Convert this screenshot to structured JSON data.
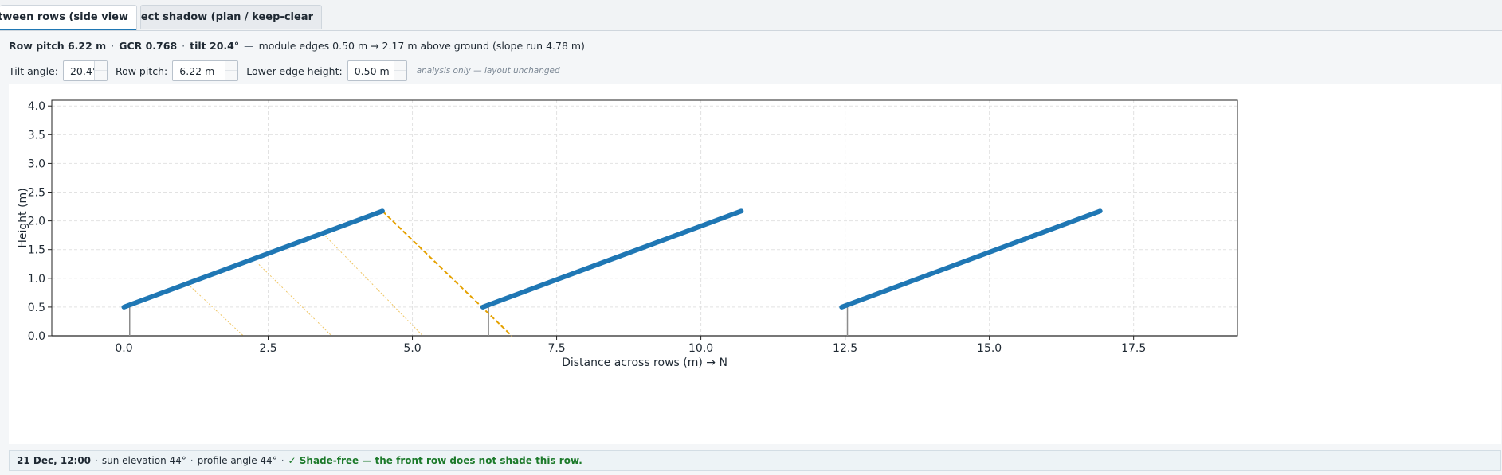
{
  "tabs": [
    {
      "label": "Shading between rows (side view",
      "active": true
    },
    {
      "label": "Object shadow (plan / keep-clear",
      "active": false
    }
  ],
  "summary": {
    "pitch": "Row pitch 6.22 m",
    "gcr": "GCR 0.768",
    "tilt": "tilt 20.4°",
    "dash": "—",
    "dot": "·",
    "details": "module edges 0.50 m → 2.17 m above ground (slope run 4.78 m)"
  },
  "controls": {
    "tilt_label": "Tilt angle:",
    "tilt_value": "20.4°",
    "pitch_label": "Row pitch:",
    "pitch_value": "6.22 m",
    "edge_label": "Lower-edge height:",
    "edge_value": "0.50 m",
    "note": "analysis only — layout unchanged"
  },
  "colors": {
    "module": "#1f77b4",
    "shade_ray": "#e5a100",
    "post": "#8c8c8c",
    "ground": "#999999",
    "ok_text": "#1c7a2a"
  },
  "chart_data": {
    "type": "line",
    "xlabel": "Distance across rows (m)  →  N",
    "ylabel": "Height (m)",
    "xlim": [
      -1.25,
      19.3
    ],
    "ylim": [
      0,
      4.1
    ],
    "xticks": [
      0,
      2.5,
      5,
      7.5,
      10,
      12.5,
      15,
      17.5
    ],
    "xtick_labels": [
      "0.0",
      "2.5",
      "5.0",
      "7.5",
      "10.0",
      "12.5",
      "15.0",
      "17.5"
    ],
    "yticks": [
      0,
      0.5,
      1,
      1.5,
      2,
      2.5,
      3,
      3.5,
      4
    ],
    "ytick_labels": [
      "0.0",
      "0.5",
      "1.0",
      "1.5",
      "2.0",
      "2.5",
      "3.0",
      "3.5",
      "4.0"
    ],
    "grid": true,
    "modules": [
      {
        "x": [
          0,
          4.48
        ],
        "y": [
          0.5,
          2.17
        ]
      },
      {
        "x": [
          6.22,
          10.7
        ],
        "y": [
          0.5,
          2.17
        ]
      },
      {
        "x": [
          12.44,
          16.92
        ],
        "y": [
          0.5,
          2.17
        ]
      }
    ],
    "posts": [
      {
        "x": 0.1,
        "y": [
          0,
          0.5
        ]
      },
      {
        "x": 6.32,
        "y": [
          0,
          0.5
        ]
      },
      {
        "x": 12.54,
        "y": [
          0,
          0.5
        ]
      }
    ],
    "shadow_rays": [
      {
        "x": [
          4.48,
          6.72
        ],
        "y": [
          2.17,
          0
        ],
        "style": "dashed"
      },
      {
        "x": [
          1.15,
          2.07
        ],
        "y": [
          0.86,
          0
        ],
        "style": "dotted"
      },
      {
        "x": [
          2.3,
          3.6
        ],
        "y": [
          1.28,
          0
        ],
        "style": "dotted"
      },
      {
        "x": [
          3.45,
          5.18
        ],
        "y": [
          1.78,
          0
        ],
        "style": "dotted"
      }
    ]
  },
  "status": {
    "date": "21 Dec, 12:00",
    "dot": "·",
    "elevation": "sun elevation 44°",
    "profile": "profile angle 44°",
    "result": "✓ Shade-free — the front row does not shade this row."
  }
}
